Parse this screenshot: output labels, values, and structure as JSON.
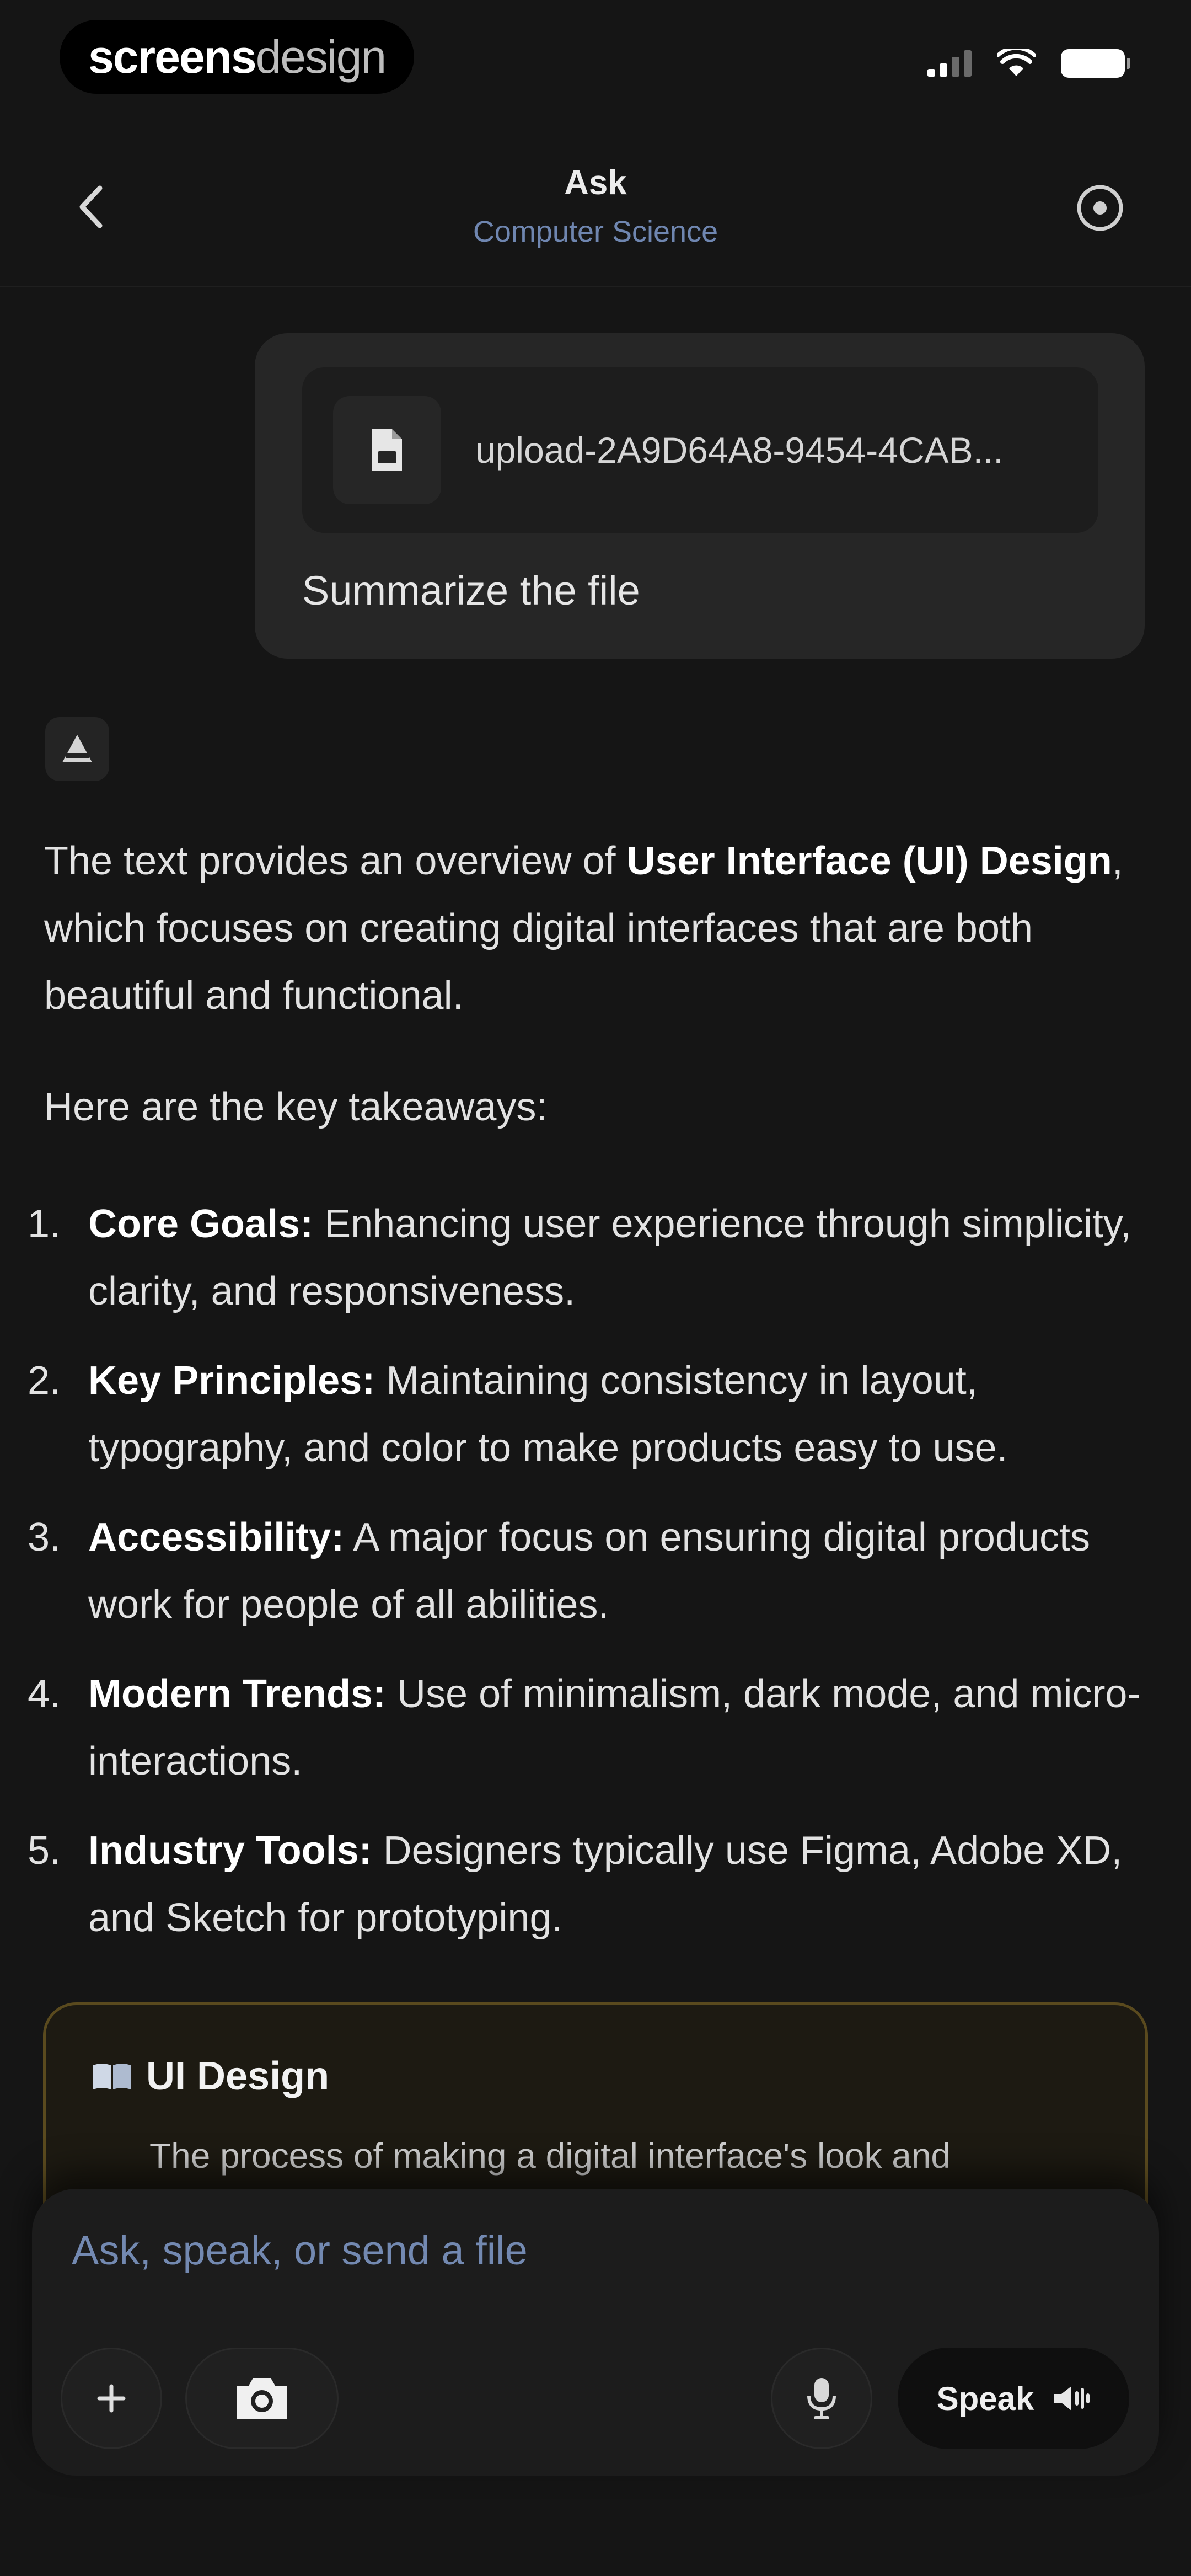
{
  "status_bar": {
    "brand_bold": "screens",
    "brand_light": "design"
  },
  "header": {
    "title": "Ask",
    "subtitle": "Computer Science",
    "icons": {
      "back": "chevron-left-icon",
      "info": "info-circle-icon"
    }
  },
  "user_message": {
    "file_name": "upload-2A9D64A8-9454-4CAB...",
    "text": "Summarize the file"
  },
  "assistant": {
    "intro_pre": "The text provides an overview of ",
    "intro_bold": "User Interface (UI) Design",
    "intro_post": ", which focuses on creating digital interfaces that are both beautiful and functional.",
    "lead": "Here are the key takeaways:",
    "takeaways": [
      {
        "num": "1.",
        "title": "Core Goals:",
        "text": " Enhancing user experience through simplicity, clarity, and responsiveness."
      },
      {
        "num": "2.",
        "title": "Key Principles:",
        "text": " Maintaining consistency in layout, typography, and color to make products easy to use."
      },
      {
        "num": "3.",
        "title": "Accessibility:",
        "text": " A major focus on ensuring digital products work for people of all abilities."
      },
      {
        "num": "4.",
        "title": "Modern Trends:",
        "text": " Use of minimalism, dark mode, and micro-interactions."
      },
      {
        "num": "5.",
        "title": "Industry Tools:",
        "text": " Designers typically use Figma, Adobe XD, and Sketch for prototyping."
      }
    ],
    "definition": {
      "title": "UI Design",
      "text": "The process of making a digital interface's look and"
    }
  },
  "composer": {
    "placeholder": "Ask, speak, or send a file",
    "speak_label": "Speak"
  },
  "colors": {
    "background": "#151515",
    "accent_subtitle": "#6f86b0",
    "card_border": "#5a4a1e"
  }
}
